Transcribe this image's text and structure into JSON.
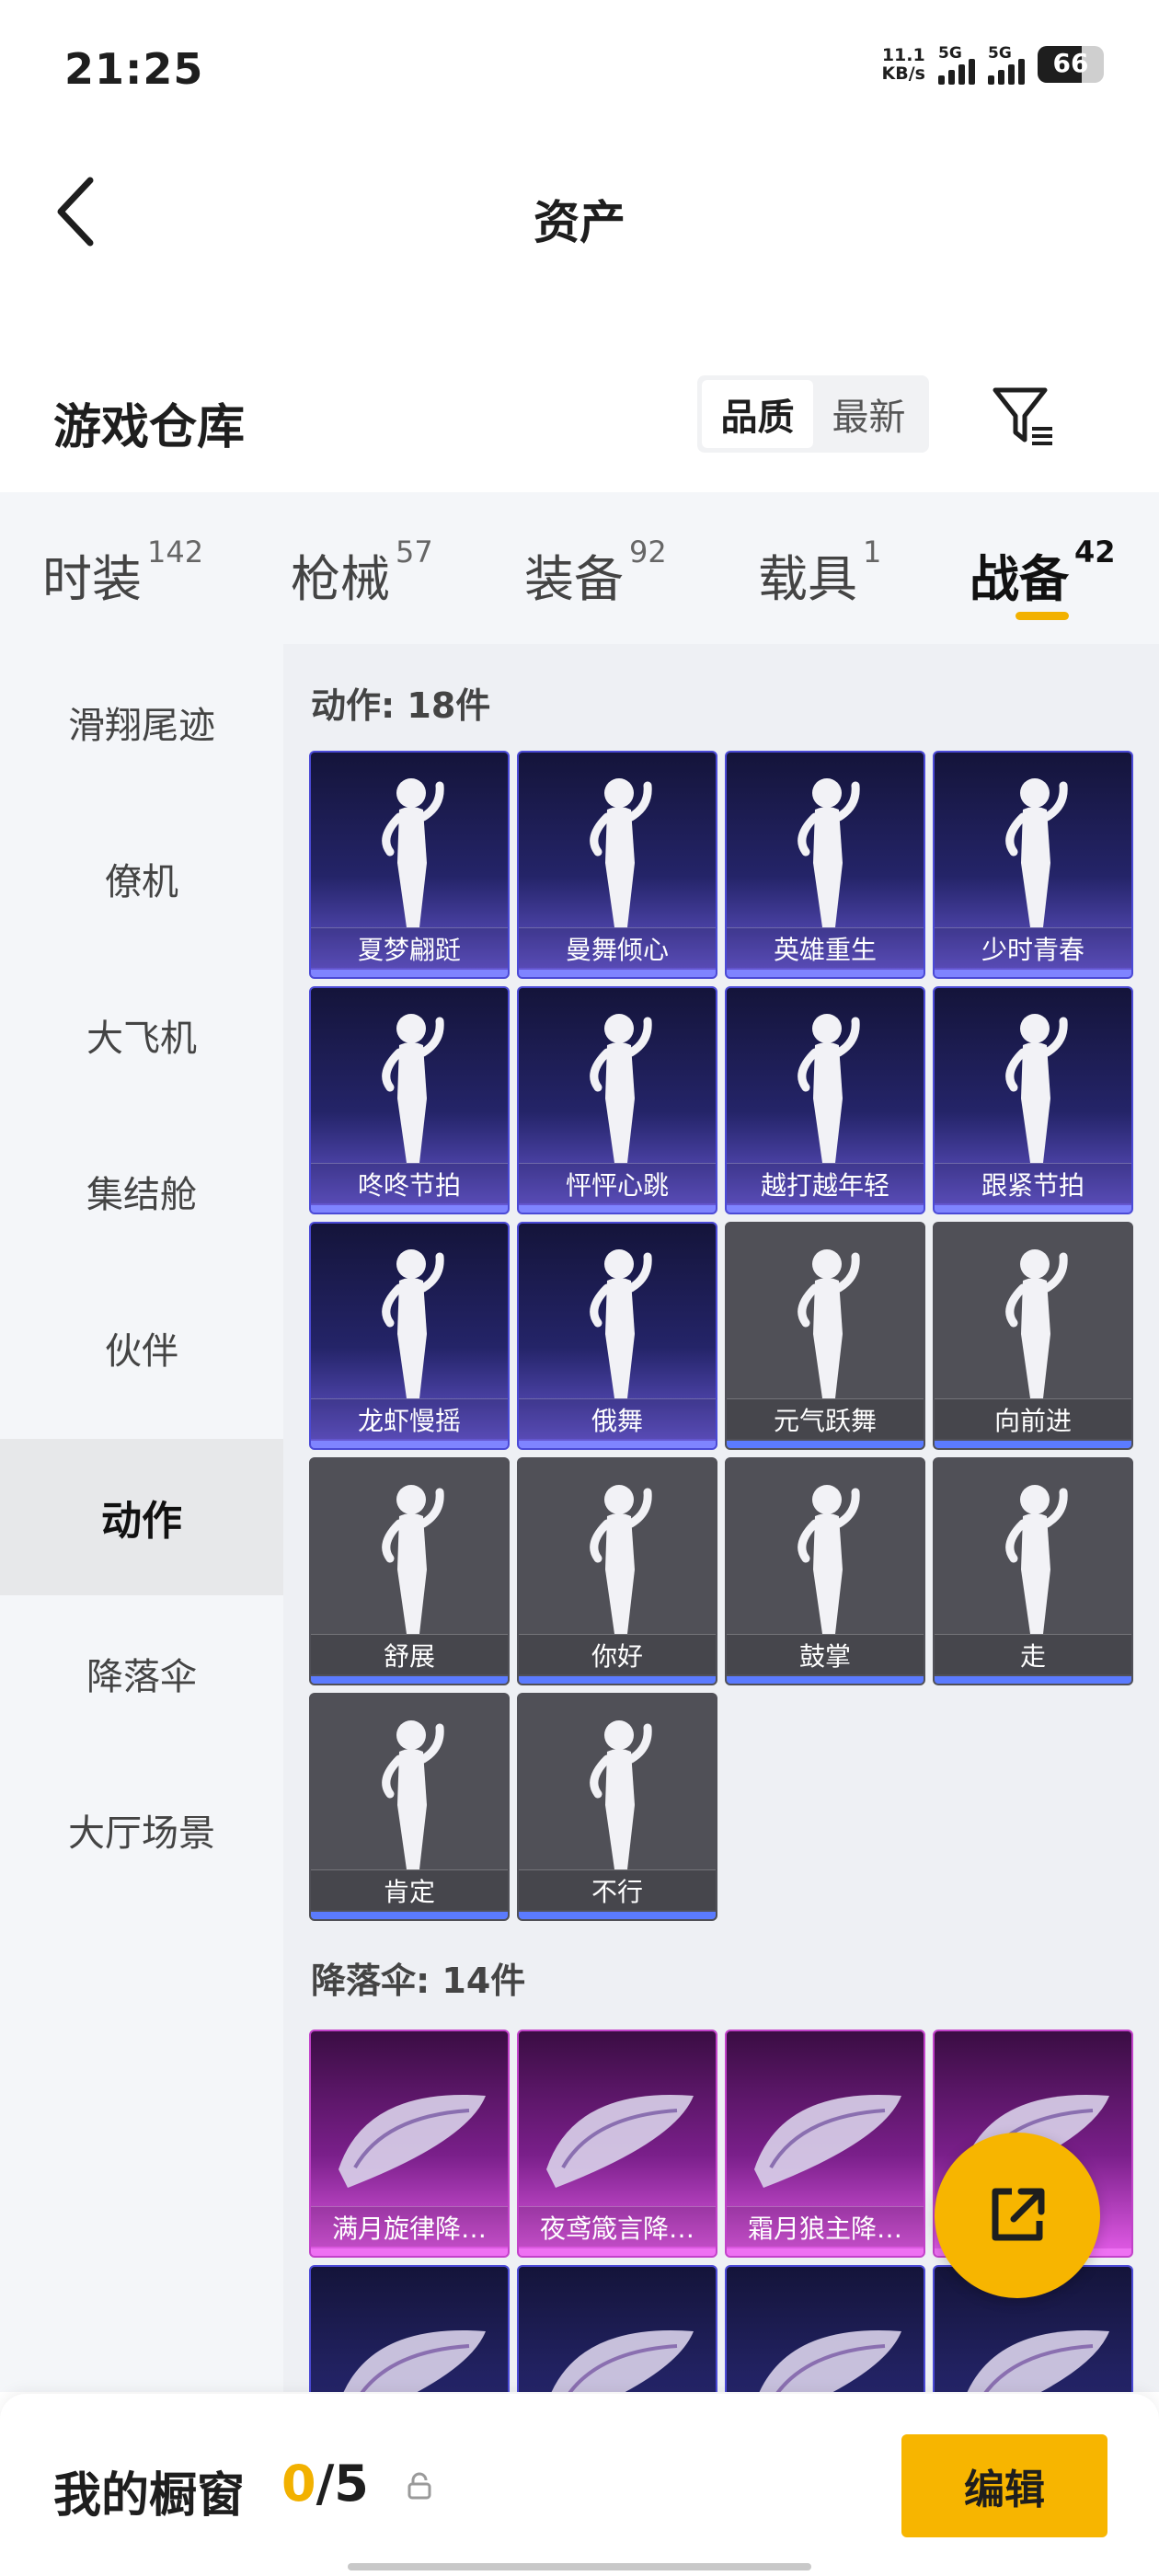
{
  "status": {
    "time": "21:25",
    "speed_value": "11.1",
    "speed_unit": "KB/s",
    "signal1": "5G",
    "signal2": "5G",
    "battery": "66"
  },
  "header": {
    "title": "资产",
    "back_icon": "chevron-left-icon"
  },
  "warehouse": {
    "title": "游戏仓库",
    "sort_options": [
      "品质",
      "最新"
    ],
    "sort_selected": "品质",
    "filter_icon": "filter-icon"
  },
  "categories": [
    {
      "label": "时装",
      "count": "142"
    },
    {
      "label": "枪械",
      "count": "57"
    },
    {
      "label": "装备",
      "count": "92"
    },
    {
      "label": "载具",
      "count": "1"
    },
    {
      "label": "战备",
      "count": "42",
      "active": true
    }
  ],
  "sidebar": {
    "items": [
      "滑翔尾迹",
      "僚机",
      "大飞机",
      "集结舱",
      "伙伴",
      "动作",
      "降落伞",
      "大厅场景"
    ],
    "active": "动作"
  },
  "sections": [
    {
      "title": "动作: 18件",
      "items": [
        {
          "name": "夏梦翩跹",
          "style": "purple"
        },
        {
          "name": "曼舞倾心",
          "style": "purple"
        },
        {
          "name": "英雄重生",
          "style": "purple"
        },
        {
          "name": "少时青春",
          "style": "purple"
        },
        {
          "name": "咚咚节拍",
          "style": "purple"
        },
        {
          "name": "怦怦心跳",
          "style": "purple"
        },
        {
          "name": "越打越年轻",
          "style": "purple"
        },
        {
          "name": "跟紧节拍",
          "style": "purple"
        },
        {
          "name": "龙虾慢摇",
          "style": "purple"
        },
        {
          "name": "俄舞",
          "style": "purple"
        },
        {
          "name": "元气跃舞",
          "style": "gray"
        },
        {
          "name": "向前进",
          "style": "gray"
        },
        {
          "name": "舒展",
          "style": "gray"
        },
        {
          "name": "你好",
          "style": "gray"
        },
        {
          "name": "鼓掌",
          "style": "gray"
        },
        {
          "name": "走",
          "style": "gray"
        },
        {
          "name": "肯定",
          "style": "gray"
        },
        {
          "name": "不行",
          "style": "gray"
        }
      ]
    },
    {
      "title": "降落伞: 14件",
      "items": [
        {
          "name": "满月旋律降…",
          "style": "magenta"
        },
        {
          "name": "夜鸢箴言降…",
          "style": "magenta"
        },
        {
          "name": "霜月狼主降…",
          "style": "magenta"
        },
        {
          "name": "",
          "style": "magenta"
        },
        {
          "name": "",
          "style": "purple"
        },
        {
          "name": "",
          "style": "purple"
        },
        {
          "name": "",
          "style": "purple"
        },
        {
          "name": "",
          "style": "purple"
        }
      ]
    }
  ],
  "fab": {
    "icon": "share-export-icon"
  },
  "showcase": {
    "title": "我的橱窗",
    "count": "0",
    "total": "/5",
    "lock_icon": "lock-icon",
    "edit_label": "编辑"
  },
  "colors": {
    "accent": "#f7b500",
    "purple_card": "#242468",
    "gray_card": "#505057",
    "magenta_card": "#7a1f8a"
  }
}
